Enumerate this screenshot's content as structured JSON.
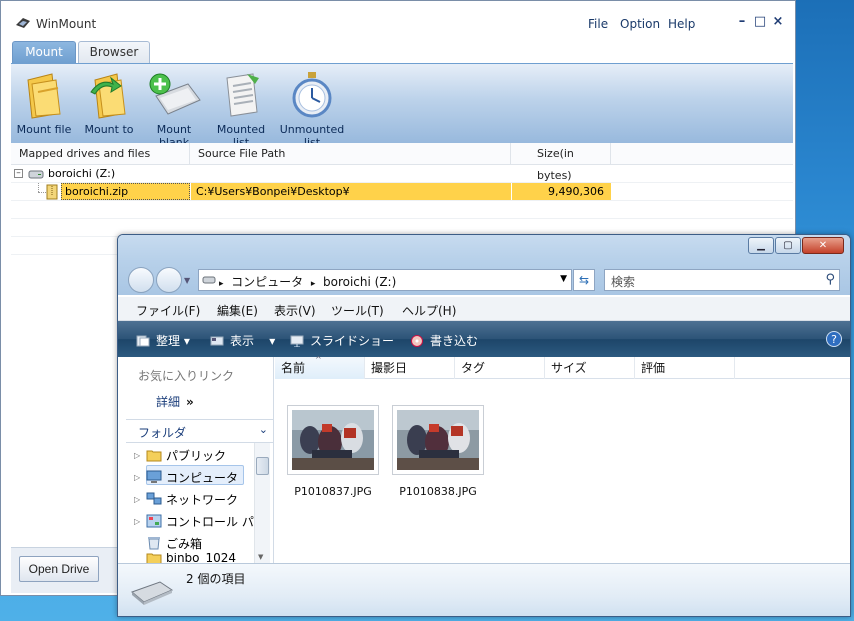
{
  "winmount": {
    "title": "WinMount",
    "menu": [
      "File",
      "Option",
      "Help"
    ],
    "tabs": [
      "Mount",
      "Browser"
    ],
    "ribbon": [
      {
        "label": "Mount file",
        "icon": "folder-mount-icon"
      },
      {
        "label": "Mount to",
        "icon": "folder-arrow-icon"
      },
      {
        "label": "Mount blank",
        "icon": "drive-add-icon"
      },
      {
        "label": "Mounted list",
        "icon": "document-list-icon"
      },
      {
        "label": "Unmounted list",
        "icon": "stopwatch-icon"
      }
    ],
    "columns": [
      "Mapped drives and files",
      "Source File Path",
      "Size(in bytes)"
    ],
    "tree": {
      "drive": "boroichi (Z:)",
      "file": {
        "name": "boroichi.zip",
        "path": "C:¥Users¥Bonpei¥Desktop¥",
        "size": "9,490,306"
      }
    },
    "open_drive_label": "Open Drive"
  },
  "explorer": {
    "breadcrumb": [
      "コンピュータ",
      "boroichi (Z:)"
    ],
    "search_placeholder": "検索",
    "menu": [
      "ファイル(F)",
      "編集(E)",
      "表示(V)",
      "ツール(T)",
      "ヘルプ(H)"
    ],
    "commands": [
      "整理",
      "表示",
      "スライドショー",
      "書き込む"
    ],
    "favorites_title": "お気に入りリンク",
    "details_label": "詳細",
    "details_arrow": "»",
    "folders_label": "フォルダ",
    "tree": [
      "パブリック",
      "コンピュータ",
      "ネットワーク",
      "コントロール パ",
      "ごみ箱",
      "binbo_1024"
    ],
    "columns": [
      "名前",
      "撮影日",
      "タグ",
      "サイズ",
      "評価"
    ],
    "files": [
      "P1010837.JPG",
      "P1010838.JPG"
    ],
    "status": "2 個の項目"
  },
  "colors": {
    "selection": "#ffd24a",
    "desktop": "#2a86cf",
    "command_bar": "#2c5377"
  }
}
